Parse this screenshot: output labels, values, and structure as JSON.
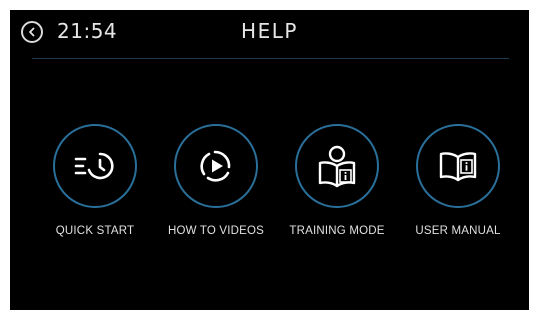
{
  "header": {
    "time": "21:54",
    "title": "HELP"
  },
  "icons": {
    "back": "chevron-left-icon",
    "quick_start": "timer-icon",
    "how_to_videos": "play-icon",
    "training_mode": "person-book-icon",
    "user_manual": "book-info-icon"
  },
  "colors": {
    "background": "#000000",
    "ring": "#2a6f9a",
    "text": "#e6e6e6"
  },
  "menu": {
    "items": [
      {
        "label": "QUICK START"
      },
      {
        "label": "HOW TO VIDEOS"
      },
      {
        "label": "TRAINING MODE"
      },
      {
        "label": "USER MANUAL"
      }
    ]
  }
}
